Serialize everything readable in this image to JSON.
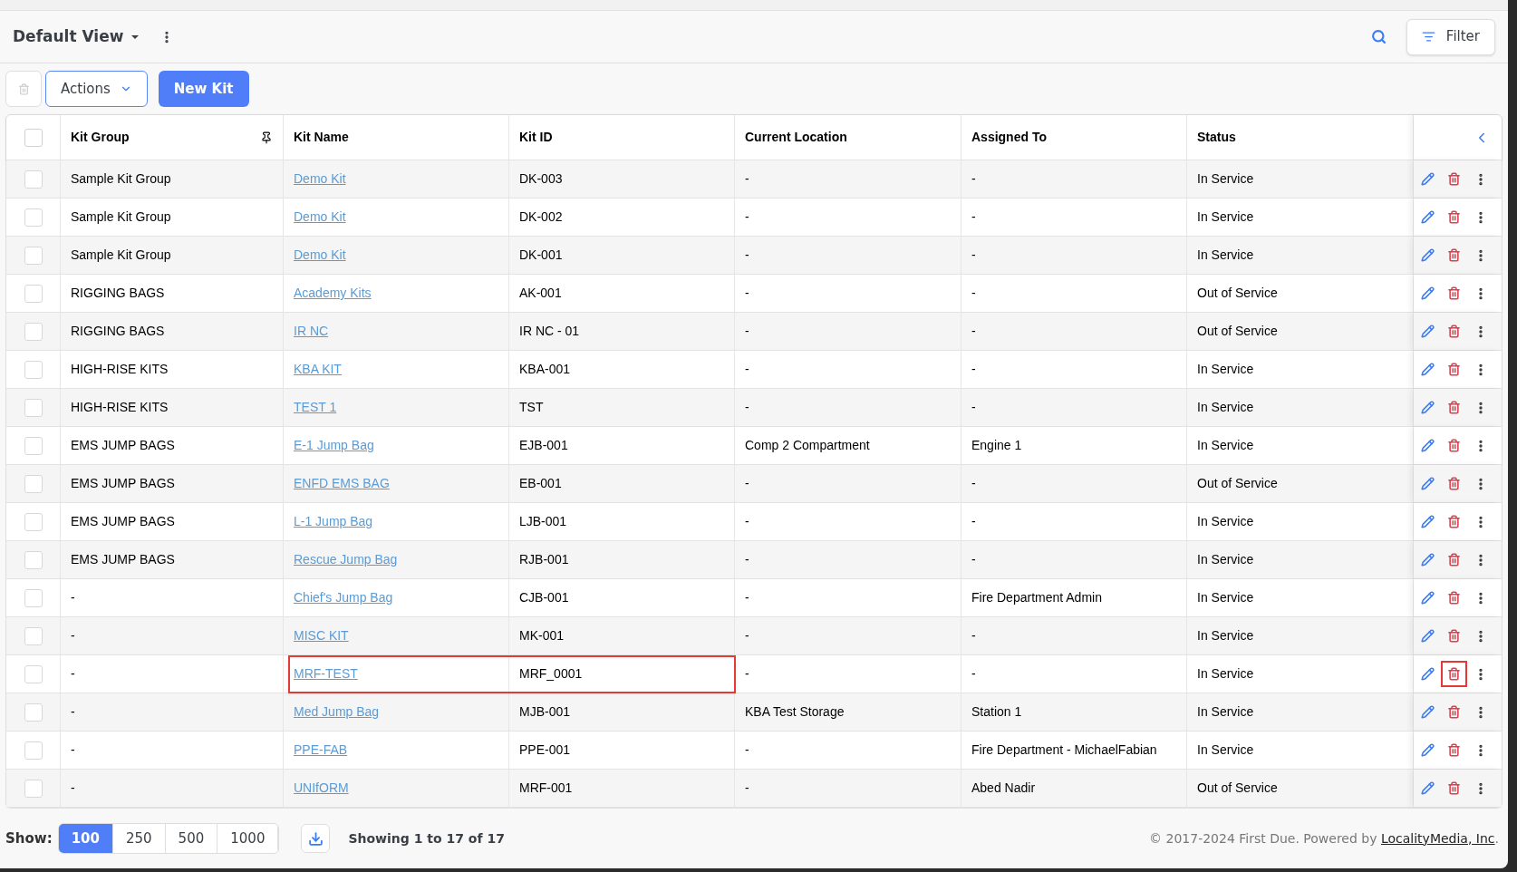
{
  "header": {
    "view_title": "Default View",
    "filter_label": "Filter"
  },
  "toolbar": {
    "actions_label": "Actions",
    "new_label": "New Kit"
  },
  "table": {
    "select_all_checked": false,
    "columns": [
      "Kit Group",
      "Kit Name",
      "Kit ID",
      "Current Location",
      "Assigned To",
      "Status"
    ],
    "rows": [
      {
        "checked": false,
        "group": "Sample Kit Group",
        "name": "Demo Kit",
        "id": "DK-003",
        "location": "-",
        "assigned": "-",
        "status": "In Service",
        "highlight_name_id": false,
        "highlight_delete": false
      },
      {
        "checked": false,
        "group": "Sample Kit Group",
        "name": "Demo Kit",
        "id": "DK-002",
        "location": "-",
        "assigned": "-",
        "status": "In Service",
        "highlight_name_id": false,
        "highlight_delete": false
      },
      {
        "checked": false,
        "group": "Sample Kit Group",
        "name": "Demo Kit",
        "id": "DK-001",
        "location": "-",
        "assigned": "-",
        "status": "In Service",
        "highlight_name_id": false,
        "highlight_delete": false
      },
      {
        "checked": false,
        "group": "RIGGING BAGS",
        "name": "Academy Kits",
        "id": "AK-001",
        "location": "-",
        "assigned": "-",
        "status": "Out of Service",
        "highlight_name_id": false,
        "highlight_delete": false
      },
      {
        "checked": false,
        "group": "RIGGING BAGS",
        "name": "IR NC",
        "id": "IR NC - 01",
        "location": "-",
        "assigned": "-",
        "status": "Out of Service",
        "highlight_name_id": false,
        "highlight_delete": false
      },
      {
        "checked": false,
        "group": "HIGH-RISE KITS",
        "name": "KBA KIT",
        "id": "KBA-001",
        "location": "-",
        "assigned": "-",
        "status": "In Service",
        "highlight_name_id": false,
        "highlight_delete": false
      },
      {
        "checked": false,
        "group": "HIGH-RISE KITS",
        "name": "TEST 1",
        "id": "TST",
        "location": "-",
        "assigned": "-",
        "status": "In Service",
        "highlight_name_id": false,
        "highlight_delete": false
      },
      {
        "checked": false,
        "group": "EMS JUMP BAGS",
        "name": "E-1 Jump Bag",
        "id": "EJB-001",
        "location": "Comp 2 Compartment",
        "assigned": "Engine 1",
        "status": "In Service",
        "highlight_name_id": false,
        "highlight_delete": false
      },
      {
        "checked": false,
        "group": "EMS JUMP BAGS",
        "name": "ENFD EMS BAG",
        "id": "EB-001",
        "location": "-",
        "assigned": "-",
        "status": "Out of Service",
        "highlight_name_id": false,
        "highlight_delete": false
      },
      {
        "checked": false,
        "group": "EMS JUMP BAGS",
        "name": "L-1 Jump Bag",
        "id": "LJB-001",
        "location": "-",
        "assigned": "-",
        "status": "In Service",
        "highlight_name_id": false,
        "highlight_delete": false
      },
      {
        "checked": false,
        "group": "EMS JUMP BAGS",
        "name": "Rescue Jump Bag",
        "id": "RJB-001",
        "location": "-",
        "assigned": "-",
        "status": "In Service",
        "highlight_name_id": false,
        "highlight_delete": false
      },
      {
        "checked": false,
        "group": "-",
        "name": "Chief's Jump Bag",
        "id": "CJB-001",
        "location": "-",
        "assigned": "Fire Department Admin",
        "status": "In Service",
        "highlight_name_id": false,
        "highlight_delete": false
      },
      {
        "checked": false,
        "group": "-",
        "name": "MISC KIT",
        "id": "MK-001",
        "location": "-",
        "assigned": "-",
        "status": "In Service",
        "highlight_name_id": false,
        "highlight_delete": false
      },
      {
        "checked": false,
        "group": "-",
        "name": "MRF-TEST",
        "id": "MRF_0001",
        "location": "-",
        "assigned": "-",
        "status": "In Service",
        "highlight_name_id": true,
        "highlight_delete": true
      },
      {
        "checked": false,
        "group": "-",
        "name": "Med Jump Bag",
        "id": "MJB-001",
        "location": "KBA Test Storage",
        "assigned": "Station 1",
        "status": "In Service",
        "highlight_name_id": false,
        "highlight_delete": false
      },
      {
        "checked": false,
        "group": "-",
        "name": "PPE-FAB",
        "id": "PPE-001",
        "location": "-",
        "assigned": "Fire Department - MichaelFabian",
        "status": "In Service",
        "highlight_name_id": false,
        "highlight_delete": false
      },
      {
        "checked": false,
        "group": "-",
        "name": "UNIfORM",
        "id": "MRF-001",
        "location": "-",
        "assigned": "Abed Nadir",
        "status": "Out of Service",
        "highlight_name_id": false,
        "highlight_delete": false
      }
    ]
  },
  "footer": {
    "show_label": "Show:",
    "page_sizes": [
      {
        "label": "100",
        "selected": true
      },
      {
        "label": "250",
        "selected": false
      },
      {
        "label": "500",
        "selected": false
      },
      {
        "label": "1000",
        "selected": false
      }
    ],
    "showing": "Showing 1 to 17 of 17",
    "copyright": "© 2017-2024 First Due. Powered by",
    "link": "LocalityMedia, Inc",
    "period": "."
  }
}
